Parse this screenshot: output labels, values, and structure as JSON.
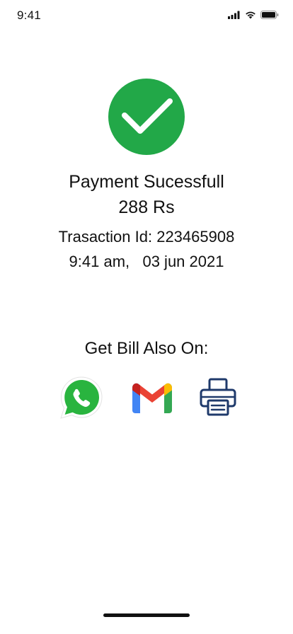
{
  "status_bar": {
    "time": "9:41",
    "icons": [
      "cellular-signal-icon",
      "wifi-icon",
      "battery-icon"
    ]
  },
  "payment": {
    "status_icon": "check-circle-icon",
    "status_color": "#22A848",
    "title": "Payment Sucessfull",
    "amount": "288 Rs",
    "transaction_id_text": "Trasaction Id: 223465908",
    "datetime_text": "9:41 am,   03 jun 2021"
  },
  "bill": {
    "heading": "Get Bill Also On:",
    "options": [
      {
        "name": "whatsapp",
        "icon": "whatsapp-icon",
        "color": "#29B43F"
      },
      {
        "name": "gmail",
        "icon": "gmail-icon",
        "color": "#EA4335"
      },
      {
        "name": "print",
        "icon": "printer-icon",
        "color": "#1F3A6B"
      }
    ]
  }
}
